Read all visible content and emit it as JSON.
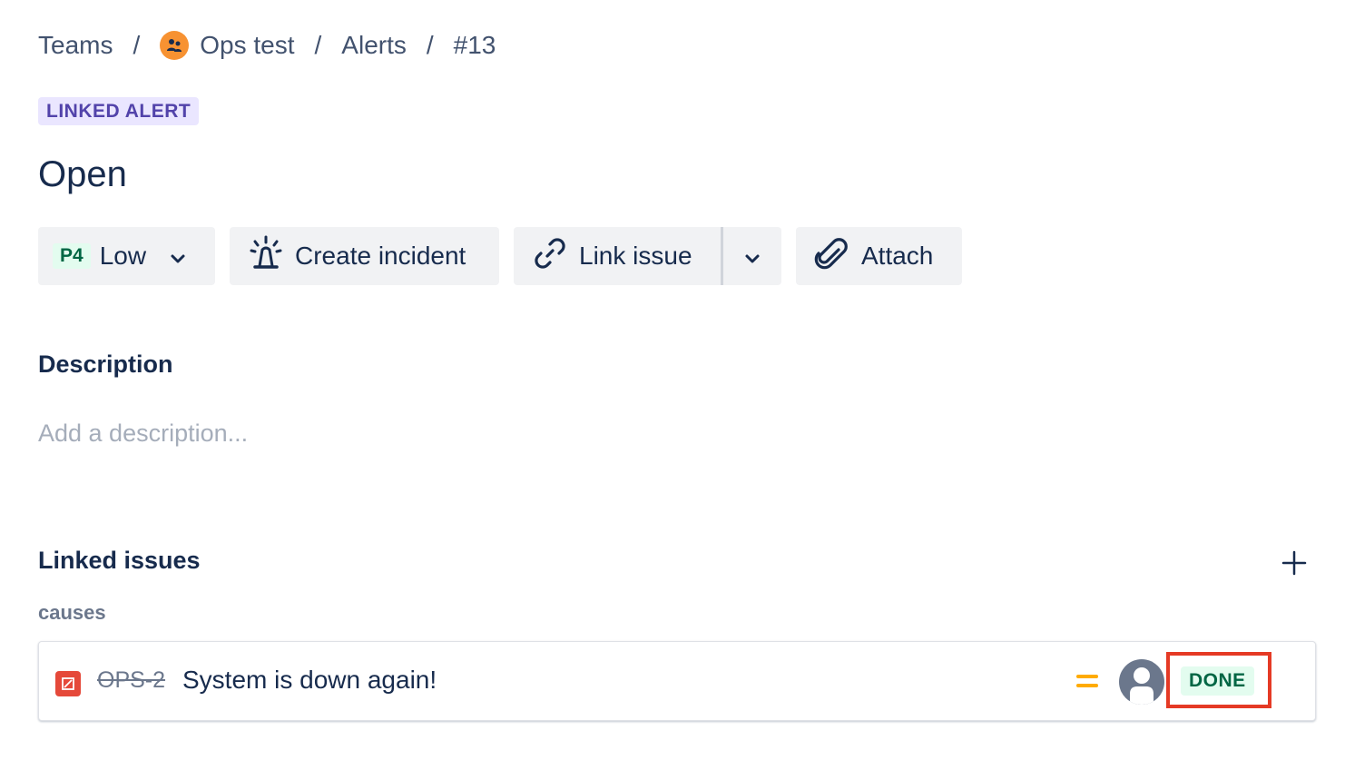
{
  "breadcrumb": {
    "teams": "Teams",
    "team": "Ops test",
    "alerts": "Alerts",
    "alert_id": "#13",
    "separator": "/"
  },
  "alert": {
    "type_lozenge": "LINKED ALERT",
    "status": "Open"
  },
  "toolbar": {
    "priority_code": "P4",
    "priority_label": "Low",
    "create_incident": "Create incident",
    "link_issue": "Link issue",
    "attach": "Attach"
  },
  "description": {
    "title": "Description",
    "placeholder": "Add a description..."
  },
  "linked_issues": {
    "title": "Linked issues",
    "groups": [
      {
        "label": "causes",
        "issues": [
          {
            "type_icon": "bug-icon",
            "key": "OPS-2",
            "summary": "System is down again!",
            "priority_icon": "priority-medium-icon",
            "assignee": "unassigned-avatar",
            "status": "DONE"
          }
        ]
      }
    ]
  },
  "colors": {
    "team_avatar": "#f79232",
    "linked_lozenge_bg": "#eae6ff",
    "linked_lozenge_text": "#5243aa",
    "done_bg": "#e3fcef",
    "done_text": "#006644",
    "bug_red": "#e5493a",
    "priority_orange": "#ffab00",
    "highlight_red": "#e53a25"
  }
}
